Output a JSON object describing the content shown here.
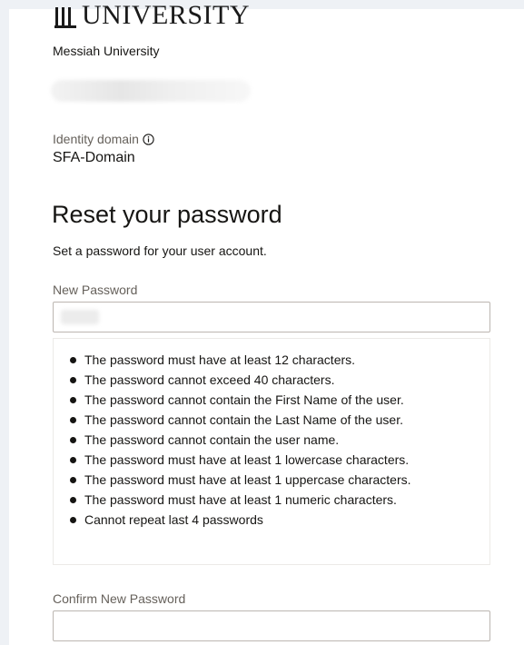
{
  "logo": {
    "text": "UNIVERSITY"
  },
  "org_name": "Messiah University",
  "identity_domain": {
    "label": "Identity domain",
    "value": "SFA-Domain",
    "info_icon": "info-circle-icon"
  },
  "reset": {
    "title": "Reset your password",
    "subtitle": "Set a password for your user account."
  },
  "new_password": {
    "label": "New Password",
    "value": ""
  },
  "rules": [
    "The password must have at least 12 characters.",
    "The password cannot exceed 40 characters.",
    "The password cannot contain the First Name of the user.",
    "The password cannot contain the Last Name of the user.",
    "The password cannot contain the user name.",
    "The password must have at least 1 lowercase characters.",
    "The password must have at least 1 uppercase characters.",
    "The password must have at least 1 numeric characters.",
    "Cannot repeat last 4 passwords"
  ],
  "confirm_password": {
    "label": "Confirm New Password",
    "value": ""
  }
}
